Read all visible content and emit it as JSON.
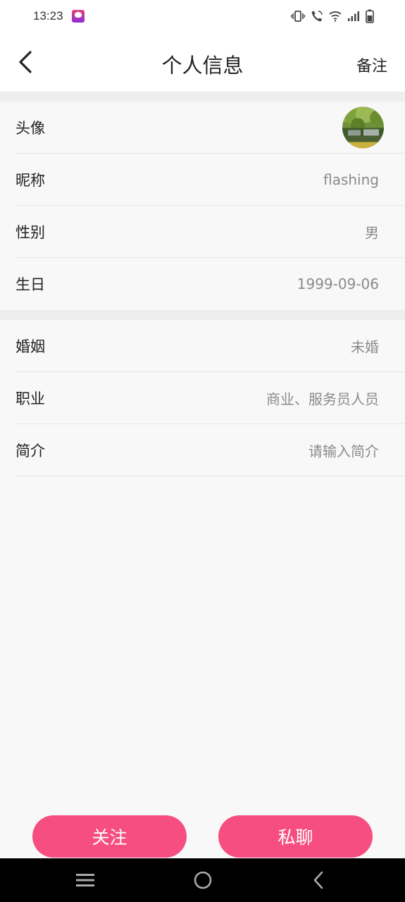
{
  "status_bar": {
    "time": "13:23",
    "icons": [
      "vibrate-icon",
      "wifi-call-icon",
      "wifi-icon",
      "signal-icon",
      "battery-icon"
    ]
  },
  "header": {
    "title": "个人信息",
    "back_icon": "chevron-left-icon",
    "remark_label": "备注"
  },
  "basic_info": {
    "avatar_label": "头像",
    "rows": [
      {
        "label": "昵称",
        "value": "flashing"
      },
      {
        "label": "性别",
        "value": "男"
      },
      {
        "label": "生日",
        "value": "1999-09-06"
      }
    ]
  },
  "extra_info": {
    "rows": [
      {
        "label": "婚姻",
        "value": "未婚"
      },
      {
        "label": "职业",
        "value": "商业、服务员人员"
      },
      {
        "label": "简介",
        "value": "请输入简介"
      }
    ]
  },
  "actions": {
    "follow_label": "关注",
    "chat_label": "私聊"
  },
  "colors": {
    "accent": "#f64e80",
    "background": "#f8f8f8",
    "value_text": "#8a8a8a"
  },
  "nav_bar": {
    "icons": [
      "menu-icon",
      "home-icon",
      "back-icon"
    ]
  }
}
